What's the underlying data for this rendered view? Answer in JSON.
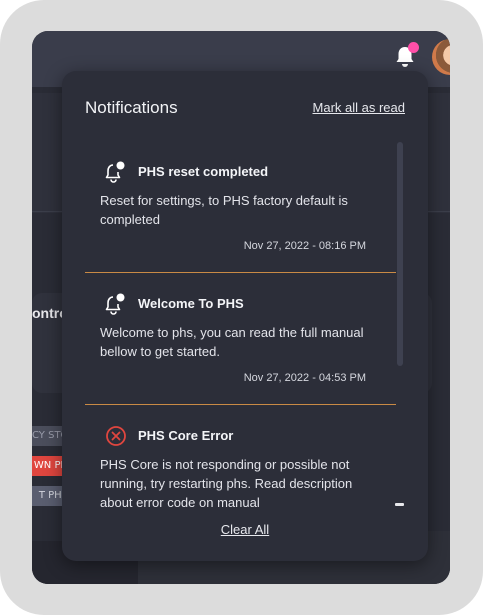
{
  "background": {
    "section_heading_fragment": "ontro",
    "chips": [
      "CY STO",
      "WN PH",
      "T PHS"
    ]
  },
  "header": {
    "notifications_icon": "bell-icon",
    "has_unread": true,
    "avatar": "avatar-image"
  },
  "panel": {
    "title": "Notifications",
    "mark_all_label": "Mark all as read",
    "clear_all_label": "Clear All",
    "items": [
      {
        "icon": "bell-alert-icon",
        "title": "PHS reset completed",
        "body": "Reset for settings, to PHS factory default is completed",
        "time": "Nov 27, 2022 - 08:16 PM"
      },
      {
        "icon": "bell-alert-icon",
        "title": "Welcome To PHS",
        "body": "Welcome to phs, you can read the full manual bellow to get started.",
        "time": "Nov 27, 2022 - 04:53 PM"
      },
      {
        "icon": "error-circle-icon",
        "title": "PHS Core Error",
        "body": "PHS Core is not responding or possible not running, try restarting phs. Read description about error code on manual",
        "time": ""
      }
    ]
  },
  "colors": {
    "divider": "#c98a45",
    "error": "#e0463f",
    "badge": "#ff4fa8"
  }
}
